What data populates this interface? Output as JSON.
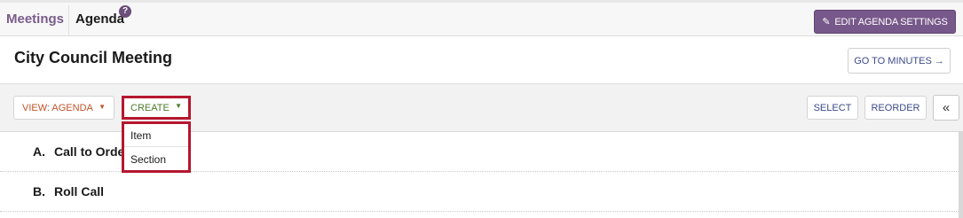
{
  "nav": {
    "meetings_label": "Meetings",
    "agenda_label": "Agenda",
    "help_badge": "?",
    "edit_button_label": "EDIT AGENDA SETTINGS",
    "edit_icon": "pencil-icon"
  },
  "header": {
    "title": "City Council Meeting",
    "minutes_button_label": "GO TO MINUTES",
    "minutes_arrow": "→"
  },
  "toolbar": {
    "view_label": "VIEW: AGENDA",
    "create_label": "CREATE",
    "select_label": "SELECT",
    "reorder_label": "REORDER",
    "collapse_label": "«"
  },
  "create_menu": {
    "items": [
      {
        "label": "Item"
      },
      {
        "label": "Section"
      }
    ]
  },
  "agenda": {
    "sections": [
      {
        "letter": "A.",
        "title": "Call to Order"
      },
      {
        "letter": "B.",
        "title": "Roll Call"
      }
    ]
  },
  "colors": {
    "accent_purple": "#77588a",
    "highlight_red": "#b5172e",
    "view_orange": "#c0542a",
    "create_green": "#4c7a2a",
    "link_blue": "#3d4a8a"
  }
}
